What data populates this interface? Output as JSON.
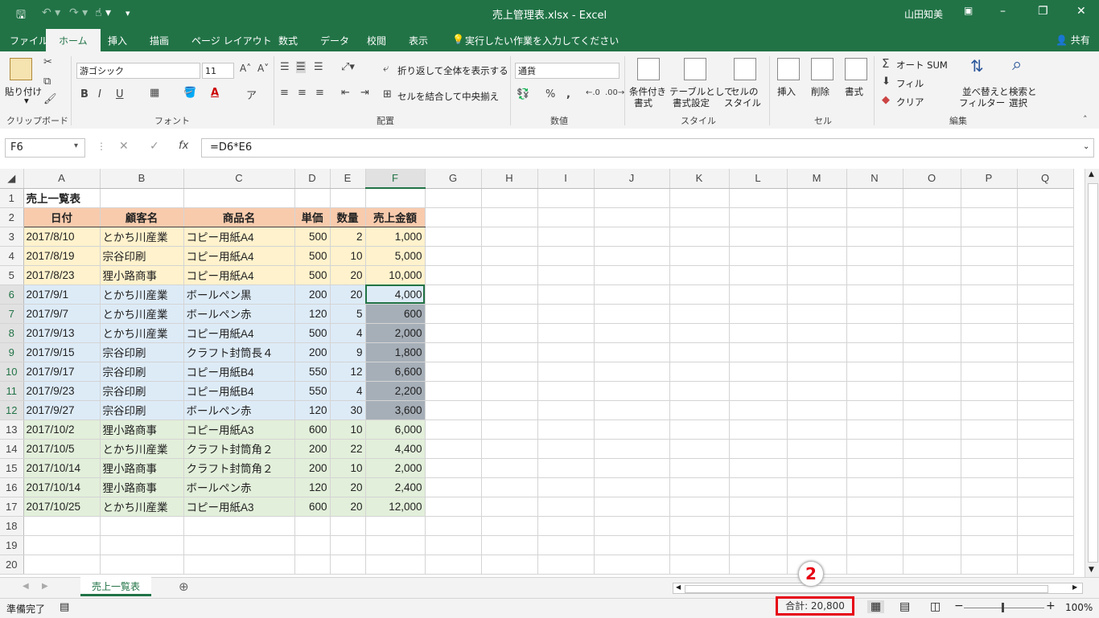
{
  "titlebar": {
    "title": "売上管理表.xlsx  -  Excel",
    "user": "山田知美",
    "save_icon": "save-icon",
    "minimize": "–",
    "restore": "❐",
    "close": "✕"
  },
  "menu": {
    "tabs": [
      "ファイル",
      "ホーム",
      "挿入",
      "描画",
      "ページ レイアウト",
      "数式",
      "データ",
      "校閲",
      "表示"
    ],
    "tell_me": "実行したい作業を入力してください",
    "share": "共有"
  },
  "ribbon": {
    "clipboard": {
      "label": "クリップボード",
      "paste": "貼り付け"
    },
    "font": {
      "label": "フォント",
      "family": "游ゴシック",
      "size": "11",
      "bold": "B",
      "italic": "I",
      "underline": "U"
    },
    "alignment": {
      "label": "配置",
      "wrap": "折り返して全体を表示する",
      "merge": "セルを結合して中央揃え"
    },
    "number": {
      "label": "数値",
      "format": "通貨",
      "percent": "%",
      "comma": ","
    },
    "styles": {
      "label": "スタイル",
      "cond": [
        "条件付き",
        "書式"
      ],
      "table": [
        "テーブルとして",
        "書式設定"
      ],
      "cell": [
        "セルの",
        "スタイル"
      ]
    },
    "cells": {
      "label": "セル",
      "insert": "挿入",
      "delete": "削除",
      "format": "書式"
    },
    "editing": {
      "label": "編集",
      "autosum": "オート SUM",
      "fill": "フィル",
      "clear": "クリア",
      "sort": [
        "並べ替えと",
        "フィルター"
      ],
      "find": [
        "検索と",
        "選択"
      ]
    }
  },
  "formula_bar": {
    "name_box": "F6",
    "formula": "=D6*E6"
  },
  "columns": [
    "A",
    "B",
    "C",
    "D",
    "E",
    "F",
    "G",
    "H",
    "I",
    "J",
    "K",
    "L",
    "M",
    "N",
    "O",
    "P",
    "Q"
  ],
  "sheet": {
    "title": "売上一覧表",
    "headers": [
      "日付",
      "顧客名",
      "商品名",
      "単価",
      "数量",
      "売上金額"
    ],
    "rows": [
      [
        "2017/8/10",
        "とかち川産業",
        "コピー用紙A4",
        "500",
        "2",
        "1,000"
      ],
      [
        "2017/8/19",
        "宗谷印刷",
        "コピー用紙A4",
        "500",
        "10",
        "5,000"
      ],
      [
        "2017/8/23",
        "狸小路商事",
        "コピー用紙A4",
        "500",
        "20",
        "10,000"
      ],
      [
        "2017/9/1",
        "とかち川産業",
        "ボールペン黒",
        "200",
        "20",
        "4,000"
      ],
      [
        "2017/9/7",
        "とかち川産業",
        "ボールペン赤",
        "120",
        "5",
        "600"
      ],
      [
        "2017/9/13",
        "とかち川産業",
        "コピー用紙A4",
        "500",
        "4",
        "2,000"
      ],
      [
        "2017/9/15",
        "宗谷印刷",
        "クラフト封筒長４",
        "200",
        "9",
        "1,800"
      ],
      [
        "2017/9/17",
        "宗谷印刷",
        "コピー用紙B4",
        "550",
        "12",
        "6,600"
      ],
      [
        "2017/9/23",
        "宗谷印刷",
        "コピー用紙B4",
        "550",
        "4",
        "2,200"
      ],
      [
        "2017/9/27",
        "宗谷印刷",
        "ボールペン赤",
        "120",
        "30",
        "3,600"
      ],
      [
        "2017/10/2",
        "狸小路商事",
        "コピー用紙A3",
        "600",
        "10",
        "6,000"
      ],
      [
        "2017/10/5",
        "とかち川産業",
        "クラフト封筒角２",
        "200",
        "22",
        "4,400"
      ],
      [
        "2017/10/14",
        "狸小路商事",
        "クラフト封筒角２",
        "200",
        "10",
        "2,000"
      ],
      [
        "2017/10/14",
        "狸小路商事",
        "ボールペン赤",
        "120",
        "20",
        "2,400"
      ],
      [
        "2017/10/25",
        "とかち川産業",
        "コピー用紙A3",
        "600",
        "20",
        "12,000"
      ]
    ]
  },
  "sheet_tab": "売上一覧表",
  "status": {
    "ready": "準備完了",
    "sum": "合計: 20,800",
    "zoom": "100%",
    "badge": "2"
  },
  "colors": {
    "accent": "#217346",
    "highlight": "#e60012"
  }
}
